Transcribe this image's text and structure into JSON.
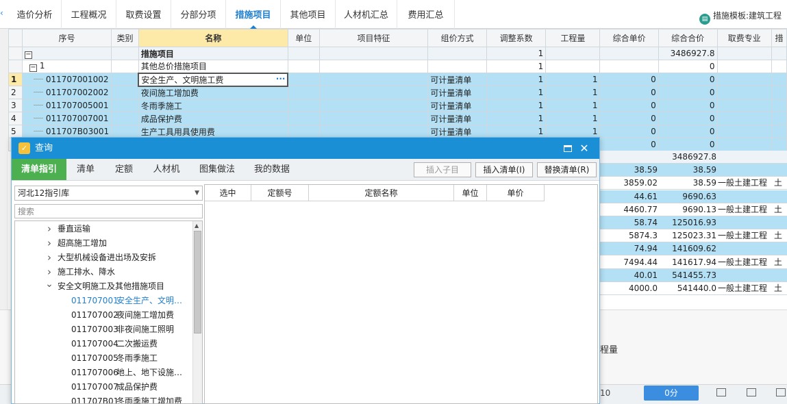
{
  "tabs": [
    "造价分析",
    "工程概况",
    "取费设置",
    "分部分项",
    "措施项目",
    "其他项目",
    "人材机汇总",
    "费用汇总"
  ],
  "active_tab": "措施项目",
  "template_label": "措施模板:建筑工程",
  "grid": {
    "headers": [
      "序号",
      "类别",
      "名称",
      "单位",
      "项目特征",
      "组价方式",
      "调整系数",
      "工程量",
      "综合单价",
      "综合合价",
      "取费专业",
      "措"
    ],
    "rows": [
      {
        "rn": "",
        "code": "",
        "cat": "",
        "name": "措施项目",
        "unit": "",
        "feature": "",
        "method": "",
        "coef": "1",
        "qty": "",
        "price": "",
        "total": "3486927.8",
        "major": "",
        "style": "light"
      },
      {
        "rn": "",
        "code": "1",
        "cat": "",
        "name": "其他总价措施项目",
        "unit": "",
        "feature": "",
        "method": "",
        "coef": "1",
        "qty": "",
        "price": "",
        "total": "0",
        "major": "",
        "style": "white"
      },
      {
        "rn": "1",
        "code": "011707001002",
        "cat": "",
        "name": "安全生产、文明施工费",
        "unit": "",
        "feature": "",
        "method": "可计量清单",
        "coef": "1",
        "qty": "1",
        "price": "0",
        "total": "0",
        "major": "",
        "style": "sel"
      },
      {
        "rn": "2",
        "code": "011707002002",
        "cat": "",
        "name": "夜间施工增加费",
        "unit": "",
        "feature": "",
        "method": "可计量清单",
        "coef": "1",
        "qty": "1",
        "price": "0",
        "total": "0",
        "major": "",
        "style": "sel"
      },
      {
        "rn": "3",
        "code": "011707005001",
        "cat": "",
        "name": "冬雨季施工",
        "unit": "",
        "feature": "",
        "method": "可计量清单",
        "coef": "1",
        "qty": "1",
        "price": "0",
        "total": "0",
        "major": "",
        "style": "sel"
      },
      {
        "rn": "4",
        "code": "011707007001",
        "cat": "",
        "name": "成品保护费",
        "unit": "",
        "feature": "",
        "method": "可计量清单",
        "coef": "1",
        "qty": "1",
        "price": "0",
        "total": "0",
        "major": "",
        "style": "sel"
      },
      {
        "rn": "5",
        "code": "011707B03001",
        "cat": "",
        "name": "生产工具用具使用费",
        "unit": "",
        "feature": "",
        "method": "可计量清单",
        "coef": "1",
        "qty": "1",
        "price": "0",
        "total": "0",
        "major": "",
        "style": "sel"
      },
      {
        "rn": "",
        "code": "",
        "cat": "",
        "name": "",
        "unit": "",
        "feature": "",
        "method": "",
        "coef": "",
        "qty": "",
        "price": "0",
        "total": "0",
        "major": "",
        "style": "sel"
      }
    ],
    "peek_rows": [
      {
        "c1": "",
        "c2": "3486927.8",
        "c3": "",
        "c4": "",
        "style": "light"
      },
      {
        "c1": "38.59",
        "c2": "38.59",
        "c3": "",
        "c4": "",
        "style": "sel"
      },
      {
        "c1": "3859.02",
        "c2": "38.59",
        "c3": "一般土建工程",
        "c4": "土",
        "style": "white"
      },
      {
        "c1": "44.61",
        "c2": "9690.63",
        "c3": "",
        "c4": "",
        "style": "sel"
      },
      {
        "c1": "4460.77",
        "c2": "9690.13",
        "c3": "一般土建工程",
        "c4": "土",
        "style": "white"
      },
      {
        "c1": "58.74",
        "c2": "125016.93",
        "c3": "",
        "c4": "",
        "style": "sel"
      },
      {
        "c1": "5874.3",
        "c2": "125023.31",
        "c3": "一般土建工程",
        "c4": "土",
        "style": "white"
      },
      {
        "c1": "74.94",
        "c2": "141609.62",
        "c3": "",
        "c4": "",
        "style": "sel"
      },
      {
        "c1": "7494.44",
        "c2": "141617.94",
        "c3": "一般土建工程",
        "c4": "土",
        "style": "white"
      },
      {
        "c1": "40.01",
        "c2": "541455.73",
        "c3": "",
        "c4": "",
        "style": "sel"
      },
      {
        "c1": "4000.0",
        "c2": "541440.0",
        "c3": "一般土建工程",
        "c4": "土",
        "style": "white"
      }
    ]
  },
  "bottom": {
    "qty_label": "程量",
    "status_num": "10",
    "score_label": "0分"
  },
  "dialog": {
    "title": "查询",
    "tabs": [
      "清单指引",
      "清单",
      "定额",
      "人材机",
      "图集做法",
      "我的数据"
    ],
    "buttons": {
      "insert_child": "插入子目",
      "insert_list": "插入清单(I)",
      "replace_list": "替换清单(R)"
    },
    "library": "河北12指引库",
    "search_placeholder": "搜索",
    "tree": [
      {
        "type": "folder",
        "label": "垂直运输",
        "expanded": false
      },
      {
        "type": "folder",
        "label": "超高施工增加",
        "expanded": false
      },
      {
        "type": "folder",
        "label": "大型机械设备进出场及安拆",
        "expanded": false
      },
      {
        "type": "folder",
        "label": "施工排水、降水",
        "expanded": false
      },
      {
        "type": "folder",
        "label": "安全文明施工及其他措施项目",
        "expanded": true
      },
      {
        "type": "leaf",
        "code": "011707001",
        "label": "安全生产、文明…",
        "selected": true
      },
      {
        "type": "leaf",
        "code": "011707002",
        "label": "夜间施工增加费",
        "selected": false
      },
      {
        "type": "leaf",
        "code": "011707003",
        "label": "非夜间施工照明",
        "selected": false
      },
      {
        "type": "leaf",
        "code": "011707004",
        "label": "二次搬运费",
        "selected": false
      },
      {
        "type": "leaf",
        "code": "011707005",
        "label": "冬雨季施工",
        "selected": false
      },
      {
        "type": "leaf",
        "code": "011707006",
        "label": "地上、地下设施…",
        "selected": false
      },
      {
        "type": "leaf",
        "code": "011707007",
        "label": "成品保护费",
        "selected": false
      },
      {
        "type": "leaf",
        "code": "011707B01",
        "label": "冬雨季施工增加费",
        "selected": false
      }
    ],
    "quota_headers": [
      "选中",
      "定额号",
      "定额名称",
      "单位",
      "单价"
    ]
  }
}
